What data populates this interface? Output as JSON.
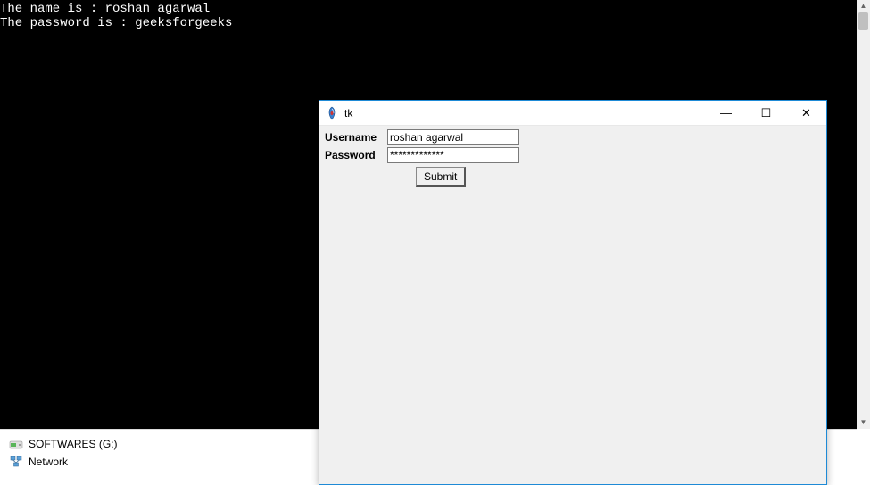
{
  "terminal": {
    "line1": "The name is : roshan agarwal",
    "line2": "The password is : geeksforgeeks"
  },
  "explorer": {
    "drive_label": "SOFTWARES (G:)",
    "network_label": "Network"
  },
  "tk_window": {
    "title": "tk",
    "username_label": "Username",
    "username_value": "roshan agarwal",
    "password_label": "Password",
    "password_value": "*************",
    "submit_label": "Submit",
    "minimize": "—",
    "maximize": "☐",
    "close": "✕"
  }
}
